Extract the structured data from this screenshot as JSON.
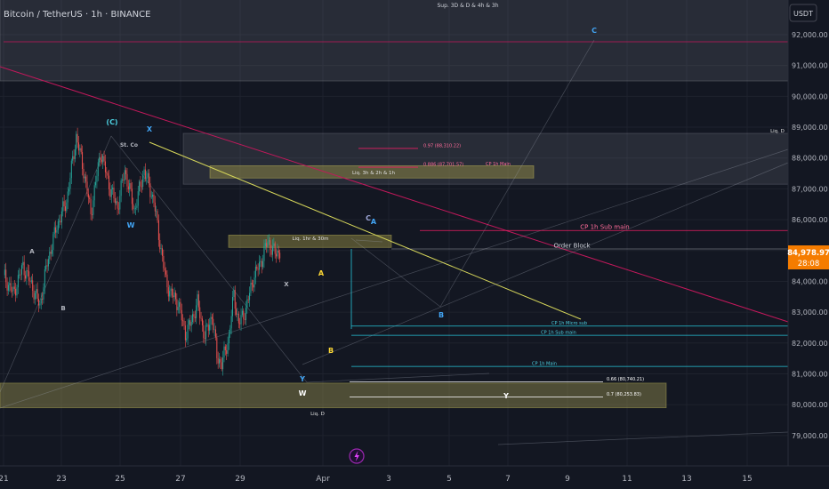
{
  "header": {
    "symbol_title": "Bitcoin / TetherUS · 1h · BINANCE",
    "top_label": "Sup. 3D & D & 4h & 3h"
  },
  "price_axis": {
    "currency": "USDT",
    "last_price": "84,978.97",
    "countdown": "28:08"
  },
  "chart_data": {
    "type": "candlestick",
    "title": "Bitcoin / TetherUS · 1h · BINANCE",
    "yticks": [
      "92,000.00",
      "91,000.00",
      "90,000.00",
      "89,000.00",
      "88,000.00",
      "87,000.00",
      "86,000.00",
      "85,000.00",
      "84,000.00",
      "83,000.00",
      "82,000.00",
      "81,000.00",
      "80,000.00",
      "79,000.00"
    ],
    "ytick_values": [
      92000,
      91000,
      90000,
      89000,
      88000,
      87000,
      86000,
      85000,
      84000,
      83000,
      82000,
      81000,
      80000,
      79000
    ],
    "ylim": [
      78000,
      93200
    ],
    "xticks": [
      "21",
      "23",
      "25",
      "27",
      "29",
      "Apr",
      "3",
      "5",
      "7",
      "9",
      "11",
      "13",
      "15"
    ],
    "last_price": 84978.97,
    "price_path": {
      "x_hours": [
        0,
        8,
        16,
        24,
        30,
        36,
        44,
        52,
        60,
        66,
        72,
        80,
        88,
        94,
        100,
        108,
        116,
        124,
        130,
        134,
        138,
        144,
        150,
        154,
        160,
        166,
        172,
        176,
        180,
        186,
        190,
        194,
        200,
        206,
        212,
        218,
        224,
        228
      ],
      "close": [
        84200,
        83600,
        84500,
        83800,
        83200,
        84600,
        85800,
        86600,
        88700,
        87600,
        86200,
        88200,
        87000,
        86400,
        87600,
        86300,
        87600,
        86600,
        85000,
        84000,
        83600,
        83300,
        82300,
        82600,
        83300,
        82200,
        82900,
        81600,
        81300,
        82200,
        83600,
        82600,
        83100,
        84100,
        84600,
        85300,
        84900,
        84979
      ]
    },
    "zones": [
      {
        "label": "Sup. 3D & D & 4h & 3h",
        "from": 90500,
        "to": 93200
      },
      {
        "label": "Liq. D",
        "from": 87150,
        "to": 88800
      },
      {
        "label": "Liq. 3h & 2h & 1h",
        "from": 87350,
        "to": 87750
      },
      {
        "label": "Liq. 1hr & 30m",
        "from": 85100,
        "to": 85500
      },
      {
        "label": "Liq. D",
        "from": 79900,
        "to": 80700
      }
    ],
    "levels": [
      {
        "label": "0.97 (88,310.22)",
        "price": 88310.22
      },
      {
        "label": "0.886 (87,701.57)",
        "price": 87701.57
      },
      {
        "label": "CP 1h Main",
        "price": 87720
      },
      {
        "label": "CP 1h Sub main",
        "price": 85650
      },
      {
        "label": "Order Block",
        "price": 85050
      },
      {
        "label": "CP 1h Micro sub",
        "price": 82550
      },
      {
        "label": "CP 1h Sub main",
        "price": 82250
      },
      {
        "label": "CP 1h Main",
        "price": 81240
      },
      {
        "label": "0.66 (80,740.21)",
        "price": 80740.21
      },
      {
        "label": "0.7 (80,253.83)",
        "price": 80253.83
      }
    ],
    "wave_labels": [
      "(C)",
      "X",
      "W",
      "A",
      "B",
      "St. Co",
      "Y",
      "W",
      "X",
      "A",
      "B",
      "C",
      "B",
      "C",
      "A",
      "Y"
    ]
  },
  "colors": {
    "background": "#131722",
    "grid": "#1e222d",
    "candle_up": "#26a69a",
    "candle_down": "#ef5350",
    "trend_yellow": "#d6d65a",
    "trend_pink": "#c2185b",
    "price_tag": "#f57c00"
  }
}
